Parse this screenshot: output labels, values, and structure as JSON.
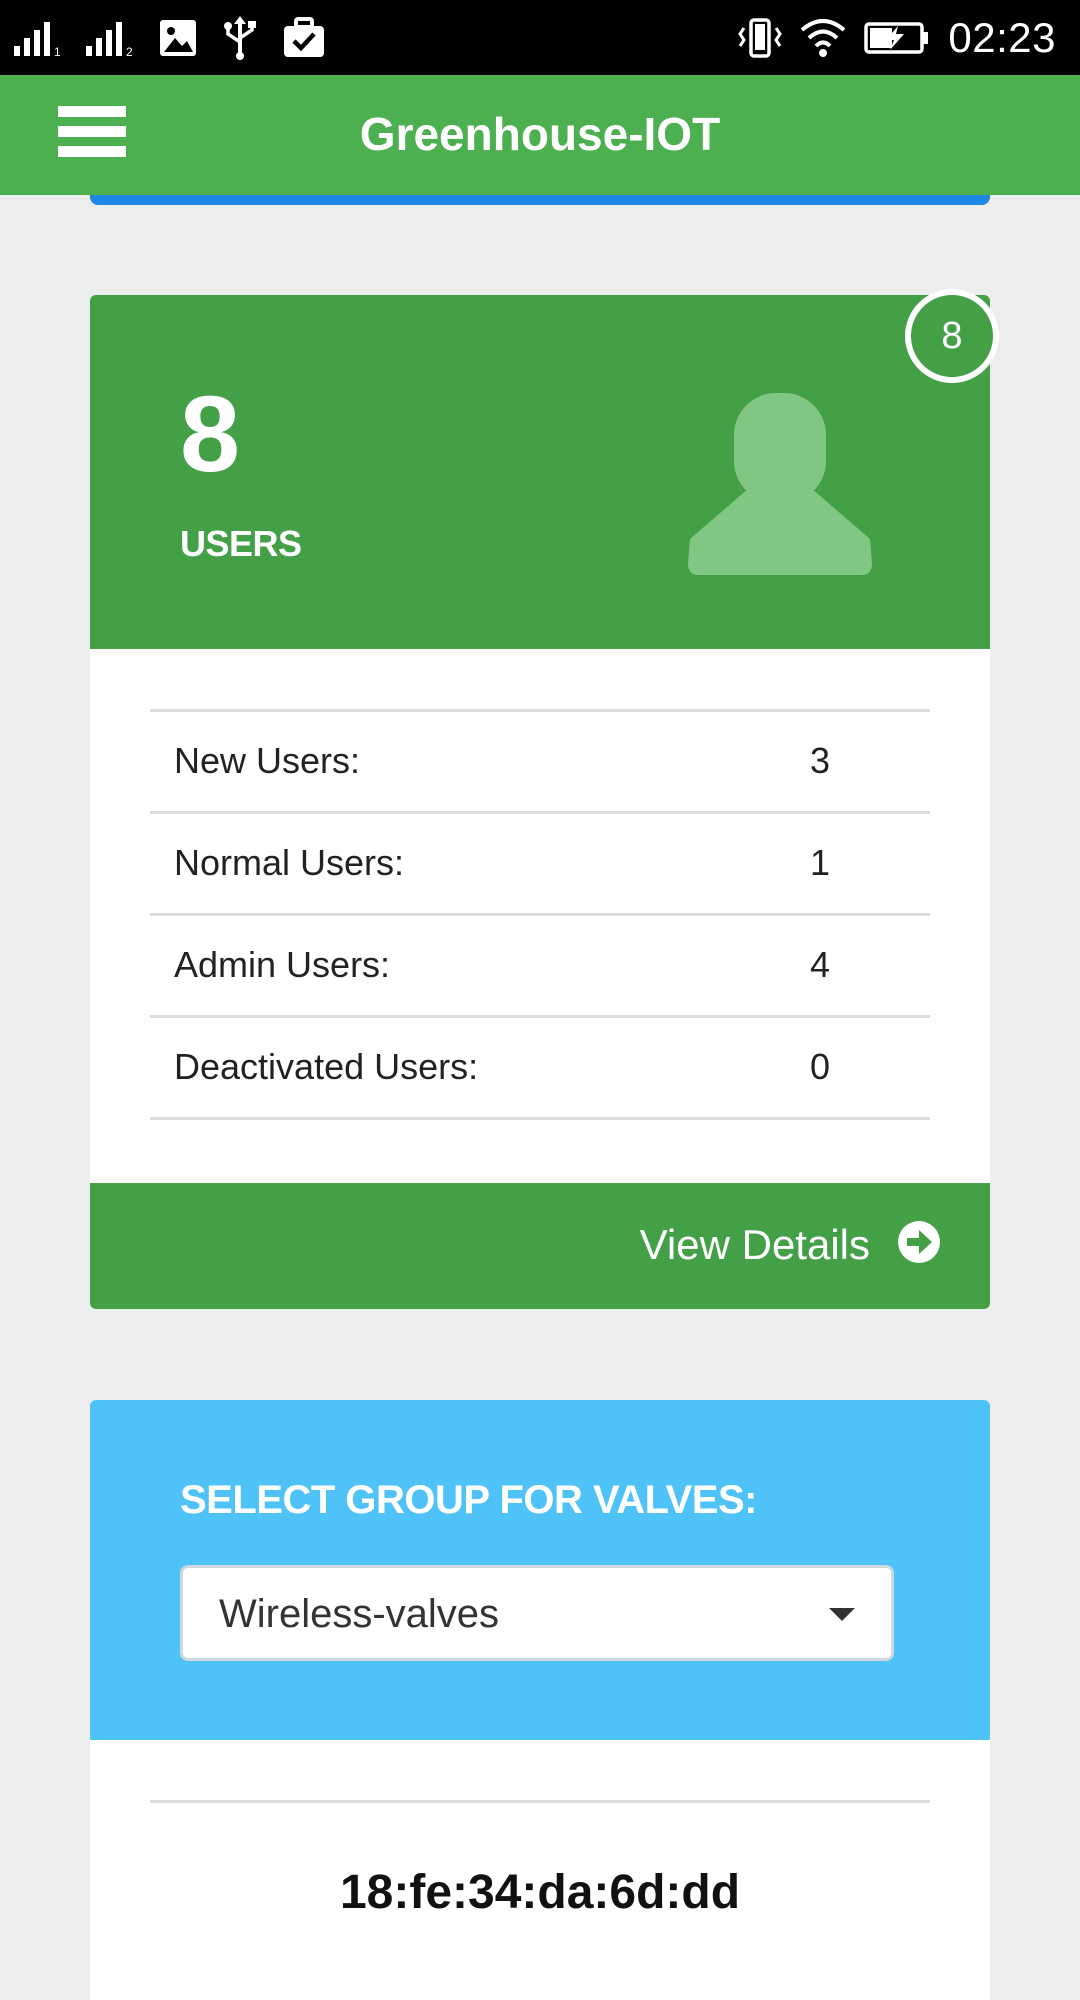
{
  "status_bar": {
    "time": "02:23",
    "sim1_label": "1",
    "sim2_label": "2",
    "icons": [
      "signal-icon",
      "signal-icon",
      "image-icon",
      "usb-icon",
      "briefcase-icon",
      "vibrate-icon",
      "wifi-icon",
      "battery-charging-icon"
    ]
  },
  "app_bar": {
    "title": "Greenhouse-IOT",
    "menu_icon": "hamburger-menu-icon"
  },
  "users_panel": {
    "count": "8",
    "label": "USERS",
    "badge": "8",
    "icon": "user-silhouette-icon",
    "rows": [
      {
        "label": "New Users:",
        "value": "3"
      },
      {
        "label": "Normal Users:",
        "value": "1"
      },
      {
        "label": "Admin Users:",
        "value": "4"
      },
      {
        "label": "Deactivated Users:",
        "value": "0"
      }
    ],
    "view_details": "View Details",
    "view_details_icon": "arrow-circle-right-icon"
  },
  "valves_panel": {
    "title": "SELECT GROUP FOR VALVES:",
    "selected_group": "Wireless-valves",
    "mac_address": "18:fe:34:da:6d:dd"
  },
  "colors": {
    "app_bar": "#4caf50",
    "users_panel": "#43a047",
    "valves_panel": "#4fc3f7",
    "accent_blue": "#1e88e5",
    "background": "#eceeed"
  }
}
